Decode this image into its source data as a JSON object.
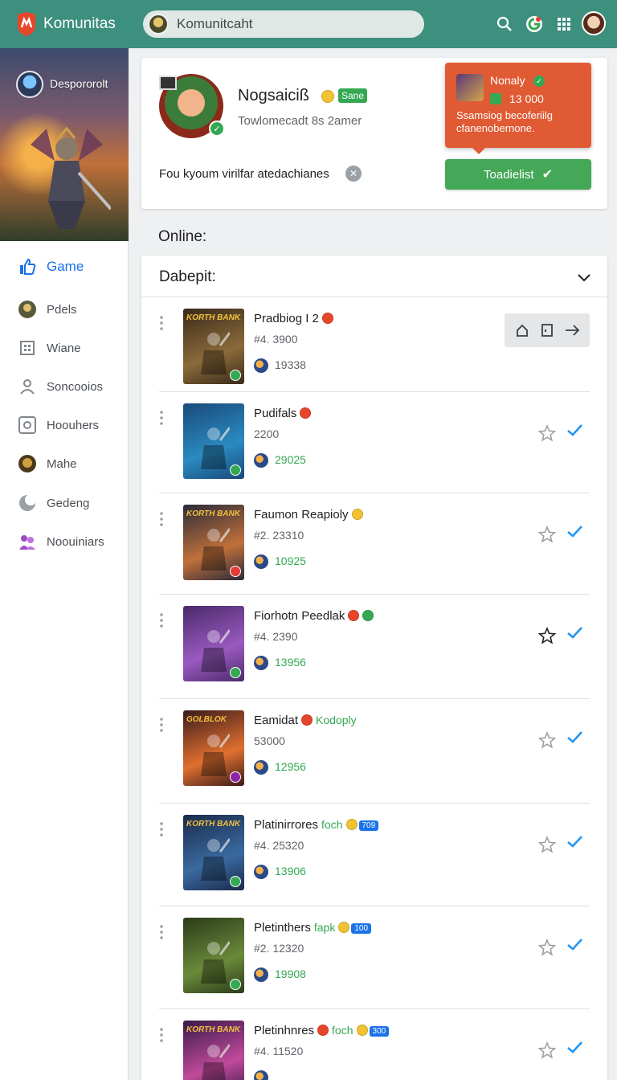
{
  "topbar": {
    "title": "Komunitas",
    "search_value": "Komunitcaht",
    "icons": [
      "search-icon",
      "google-icon",
      "apps-grid-icon",
      "account-avatar"
    ],
    "accent": "#3d8f7e"
  },
  "sidebar": {
    "hero_name": "Despororolt",
    "items": [
      {
        "label": "Game",
        "icon": "thumbs-up-icon",
        "active": true
      },
      {
        "label": "Pdels",
        "icon": "avatar-icon",
        "active": false
      },
      {
        "label": "Wiane",
        "icon": "grid-icon",
        "active": false
      },
      {
        "label": "Soncooios",
        "icon": "person-icon",
        "active": false
      },
      {
        "label": "Hoouhers",
        "icon": "badge-icon",
        "active": false
      },
      {
        "label": "Mahe",
        "icon": "avatar-icon",
        "active": false
      },
      {
        "label": "Gedeng",
        "icon": "moon-icon",
        "active": false
      },
      {
        "label": "Noouiniars",
        "icon": "group-icon",
        "active": false
      }
    ]
  },
  "profile": {
    "name": "Nogsaiciß",
    "tag": "Sane",
    "subtitle": "Towlomecadt 8s 2amer",
    "message": "Fou kyoum virilfar atedachianes"
  },
  "notification": {
    "title": "Nonaly",
    "count": "13 000",
    "text": "Ssamsiog becoferiilg cfanenobernone."
  },
  "primary_button": {
    "label": "Toadielist"
  },
  "section": {
    "title": "Online:"
  },
  "list": {
    "header": "Dabepit:",
    "rows": [
      {
        "title": "Pradbiog I 2",
        "extra": "",
        "badge": "",
        "id": "#4. 3900",
        "stat": "19338",
        "stat_green": false,
        "colors": [
          "#3a2a1a",
          "#8a6a3a"
        ],
        "thumb_label": "KORTH BANK",
        "badge_color": "#34a853",
        "action_box": true
      },
      {
        "title": "Pudifals",
        "extra": "",
        "badge": "",
        "id": "2200",
        "stat": "29025",
        "stat_green": true,
        "colors": [
          "#1a4a7a",
          "#2a8ac0"
        ],
        "thumb_label": "",
        "badge_color": "#34a853",
        "action_box": false
      },
      {
        "title": "Faumon Reapioly",
        "extra": "",
        "badge": "",
        "id": "#2. 23310",
        "stat": "10925",
        "stat_green": true,
        "colors": [
          "#2a2a3a",
          "#c0703a"
        ],
        "thumb_label": "KORTH BANK",
        "badge_color": "#e53935",
        "action_box": false
      },
      {
        "title": "Fiorhotn Peedlak",
        "extra": "",
        "badge": "",
        "id": "#4. 2390",
        "stat": "13956",
        "stat_green": true,
        "colors": [
          "#4a2a6a",
          "#9a5ac0"
        ],
        "thumb_label": "",
        "badge_color": "#34a853",
        "action_box": false
      },
      {
        "title": "Eamidat",
        "extra": "Kodoply",
        "badge": "",
        "id": "53000",
        "stat": "12956",
        "stat_green": true,
        "colors": [
          "#3a1a1a",
          "#e07030"
        ],
        "thumb_label": "GOLBLOK",
        "badge_color": "#8e24aa",
        "action_box": false
      },
      {
        "title": "Platinirrores",
        "extra": "foch",
        "badge": "709",
        "id": "#4. 25320",
        "stat": "13906",
        "stat_green": true,
        "colors": [
          "#1a2a4a",
          "#3a6aa0"
        ],
        "thumb_label": "KORTH BANK",
        "badge_color": "#34a853",
        "action_box": false
      },
      {
        "title": "Pletinthers",
        "extra": "fapk",
        "badge": "100",
        "id": "#2. 12320",
        "stat": "19908",
        "stat_green": true,
        "colors": [
          "#2a3a1a",
          "#6a8a3a"
        ],
        "thumb_label": "",
        "badge_color": "#34a853",
        "action_box": false
      },
      {
        "title": "Pletinhnres",
        "extra": "foch",
        "badge": "300",
        "id": "#4. 11520",
        "stat": "",
        "stat_green": true,
        "colors": [
          "#3a1a4a",
          "#c04a9a"
        ],
        "thumb_label": "KORTH BANK",
        "badge_color": "#34a853",
        "action_box": false
      }
    ]
  }
}
